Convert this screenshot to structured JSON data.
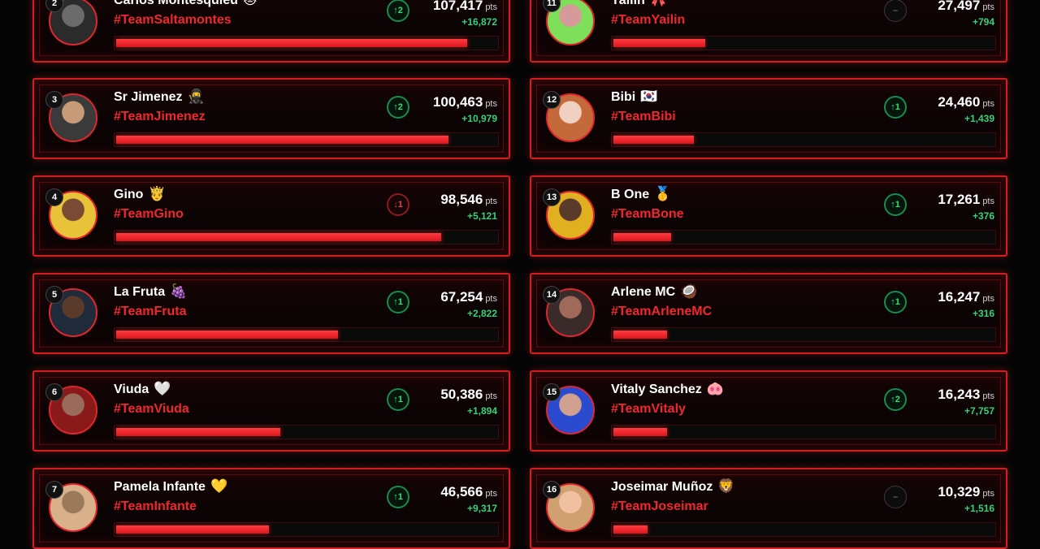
{
  "pts_unit": "pts",
  "colors": {
    "accent": "#d11d23",
    "team": "#f0282e",
    "up": "#2ee07a",
    "down": "#e2444a",
    "background": "#050505"
  },
  "left_column": [
    {
      "rank": "2",
      "name": "Carlos Montesquieu",
      "emoji": "🐱",
      "team": "#TeamSaltamontes",
      "trend": "up",
      "trend_label": "↑2",
      "points": "107,417",
      "delta": "+16,872",
      "progress": 0.92,
      "avatar_colors": [
        "#2b2b2b",
        "#6b6b6b"
      ]
    },
    {
      "rank": "3",
      "name": "Sr Jimenez",
      "emoji": "🥷",
      "team": "#TeamJimenez",
      "trend": "up",
      "trend_label": "↑2",
      "points": "100,463",
      "delta": "+10,979",
      "progress": 0.87,
      "avatar_colors": [
        "#3a3a3a",
        "#c79a78"
      ]
    },
    {
      "rank": "4",
      "name": "Gino",
      "emoji": "🤴",
      "team": "#TeamGino",
      "trend": "down",
      "trend_label": "↓1",
      "points": "98,546",
      "delta": "+5,121",
      "progress": 0.85,
      "avatar_colors": [
        "#e8c33a",
        "#7a4a34"
      ]
    },
    {
      "rank": "5",
      "name": "La Fruta",
      "emoji": "🍇",
      "team": "#TeamFruta",
      "trend": "up",
      "trend_label": "↑1",
      "points": "67,254",
      "delta": "+2,822",
      "progress": 0.58,
      "avatar_colors": [
        "#1f2a3a",
        "#5a3a2a"
      ]
    },
    {
      "rank": "6",
      "name": "Viuda",
      "emoji": "🤍",
      "team": "#TeamViuda",
      "trend": "up",
      "trend_label": "↑1",
      "points": "50,386",
      "delta": "+1,894",
      "progress": 0.43,
      "avatar_colors": [
        "#8a1a1a",
        "#9a6a5a"
      ]
    },
    {
      "rank": "7",
      "name": "Pamela Infante",
      "emoji": "💛",
      "team": "#TeamInfante",
      "trend": "up",
      "trend_label": "↑1",
      "points": "46,566",
      "delta": "+9,317",
      "progress": 0.4,
      "avatar_colors": [
        "#d8b08a",
        "#9a7a5a"
      ]
    }
  ],
  "right_column": [
    {
      "rank": "11",
      "name": "Yailin",
      "emoji": "🎀",
      "team": "#TeamYailin",
      "trend": "same",
      "trend_label": "–",
      "points": "27,497",
      "delta": "+794",
      "progress": 0.24,
      "avatar_colors": [
        "#7ee05a",
        "#d69a9a"
      ]
    },
    {
      "rank": "12",
      "name": "Bibi",
      "emoji": "🇰🇷",
      "team": "#TeamBibi",
      "trend": "up",
      "trend_label": "↑1",
      "points": "24,460",
      "delta": "+1,439",
      "progress": 0.21,
      "avatar_colors": [
        "#c46a3a",
        "#f0d0c0"
      ]
    },
    {
      "rank": "13",
      "name": "B One",
      "emoji": "🥇",
      "team": "#TeamBone",
      "trend": "up",
      "trend_label": "↑1",
      "points": "17,261",
      "delta": "+376",
      "progress": 0.15,
      "avatar_colors": [
        "#e0b020",
        "#5a3a2a"
      ]
    },
    {
      "rank": "14",
      "name": "Arlene MC",
      "emoji": "🥥",
      "team": "#TeamArleneMC",
      "trend": "up",
      "trend_label": "↑1",
      "points": "16,247",
      "delta": "+316",
      "progress": 0.14,
      "avatar_colors": [
        "#3a2a2a",
        "#a06a5a"
      ]
    },
    {
      "rank": "15",
      "name": "Vitaly Sanchez",
      "emoji": "🐽",
      "team": "#TeamVitaly",
      "trend": "up",
      "trend_label": "↑2",
      "points": "16,243",
      "delta": "+7,757",
      "progress": 0.14,
      "avatar_colors": [
        "#2a4ad0",
        "#d0a090"
      ]
    },
    {
      "rank": "16",
      "name": "Joseimar Muñoz",
      "emoji": "🦁",
      "team": "#TeamJoseimar",
      "trend": "same",
      "trend_label": "–",
      "points": "10,329",
      "delta": "+1,516",
      "progress": 0.09,
      "avatar_colors": [
        "#d0a070",
        "#f0c0a0"
      ]
    }
  ]
}
